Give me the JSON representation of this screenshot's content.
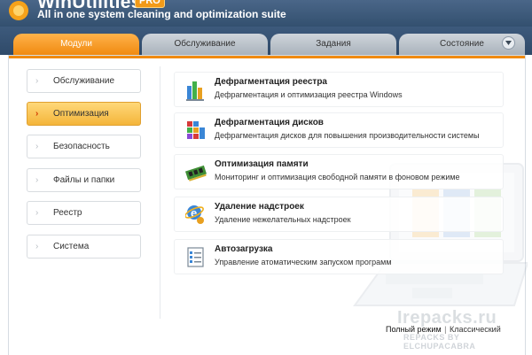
{
  "header": {
    "app_name": "WinUtilities",
    "badge": "PRO",
    "subtitle": "All in one system cleaning and optimization suite"
  },
  "tabs": [
    {
      "label": "Модули",
      "active": true
    },
    {
      "label": "Обслуживание",
      "active": false
    },
    {
      "label": "Задания",
      "active": false
    },
    {
      "label": "Состояние",
      "active": false
    }
  ],
  "sidebar": {
    "items": [
      {
        "label": "Обслуживание",
        "active": false
      },
      {
        "label": "Оптимизация",
        "active": true
      },
      {
        "label": "Безопасность",
        "active": false
      },
      {
        "label": "Файлы и папки",
        "active": false
      },
      {
        "label": "Реестр",
        "active": false
      },
      {
        "label": "Система",
        "active": false
      }
    ]
  },
  "tasks": [
    {
      "title": "Дефрагментация реестра",
      "desc": "Дефрагментация и оптимизация реестра Windows",
      "icon": "registry-defrag-icon"
    },
    {
      "title": "Дефрагментация дисков",
      "desc": "Дефрагментация дисков для повышения производительности системы",
      "icon": "disk-defrag-icon"
    },
    {
      "title": "Оптимизация памяти",
      "desc": "Мониторинг и оптимизация свободной памяти в фоновом режиме",
      "icon": "memory-chip-icon"
    },
    {
      "title": "Удаление надстроек",
      "desc": "Удаление нежелательных надстроек",
      "icon": "ie-addons-icon"
    },
    {
      "title": "Автозагрузка",
      "desc": "Управление атоматическим запуском программ",
      "icon": "startup-list-icon"
    }
  ],
  "footer": {
    "mode_full": "Полный режим",
    "mode_separator": "|",
    "mode_classic": "Классический"
  },
  "watermark": {
    "line1": "Irepacks.ru",
    "line2": "REPACKS BY ELCHUPACABRA"
  },
  "colors": {
    "accent": "#f08a10",
    "header_bg": "#3d5a7c",
    "active_side": "#f4b53a"
  }
}
